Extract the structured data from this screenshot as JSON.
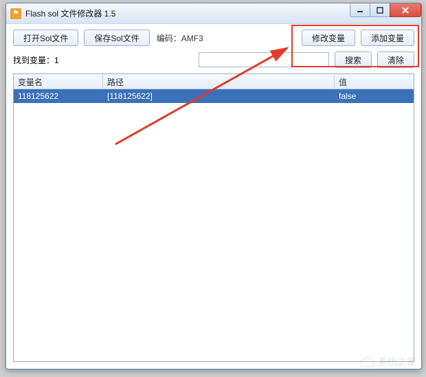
{
  "title": "Flash sol 文件修改器 1.5",
  "toolbar": {
    "open_label": "打开Sol文件",
    "save_label": "保存Sol文件",
    "encoding_label": "编码：",
    "encoding_value": "AMF3",
    "modify_label": "修改变量",
    "add_label": "添加变量"
  },
  "searchbar": {
    "found_prefix": "找到变量：",
    "found_count": "1",
    "input_value": "",
    "search_label": "搜索",
    "clear_label": "清除"
  },
  "table": {
    "headers": {
      "name": "变量名",
      "path": "路径",
      "value": "值"
    },
    "rows": [
      {
        "name": "118125622",
        "path": "[118125622]",
        "value": "false"
      }
    ]
  },
  "watermark": "系统之家"
}
